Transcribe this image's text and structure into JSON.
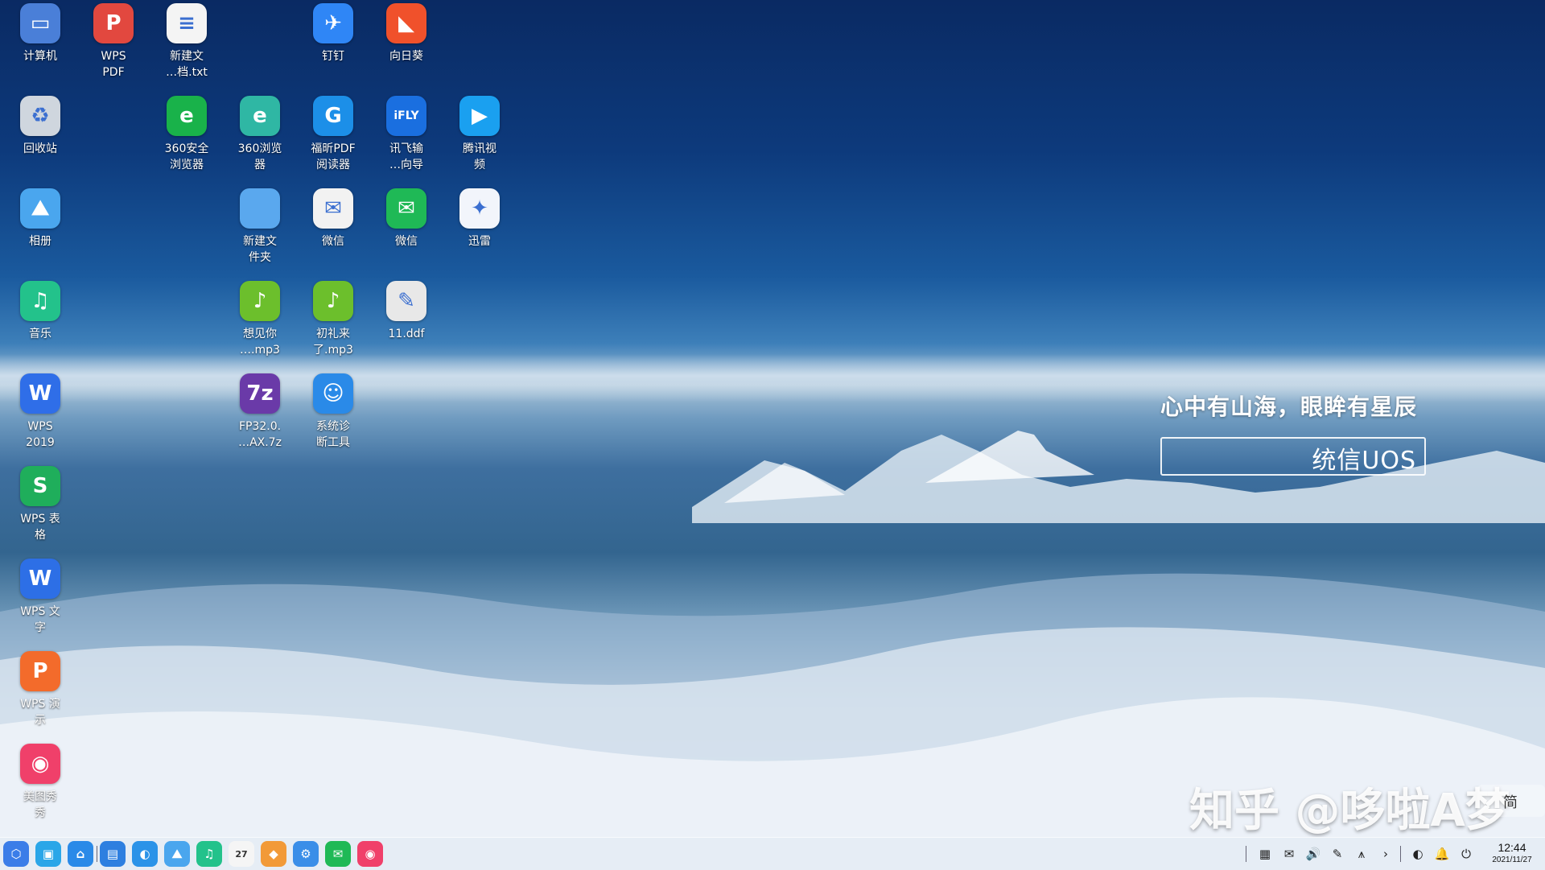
{
  "desktop": {
    "icons": [
      {
        "label": "计算机",
        "glyph": "▭",
        "color": "#4a7fd8",
        "icon": "computer-icon"
      },
      {
        "label": "WPS\nPDF",
        "glyph": "P",
        "color": "#e2483f",
        "icon": "wps-pdf-icon"
      },
      {
        "label": "新建文\n…档.txt",
        "glyph": "≡",
        "color": "#f4f4f4",
        "icon": "text-file-icon"
      },
      {
        "label": "钉钉",
        "glyph": "✈",
        "color": "#2f86f6",
        "icon": "dingtalk-icon"
      },
      {
        "label": "向日葵",
        "glyph": "◣",
        "color": "#f0512b",
        "icon": "sunflower-icon"
      },
      {
        "label": "回收站",
        "glyph": "♻",
        "color": "#cfd6de",
        "icon": "trash-icon"
      },
      {
        "label": "360安全\n浏览器",
        "glyph": "e",
        "color": "#19b24a",
        "icon": "360-secure-browser-icon"
      },
      {
        "label": "360浏览\n器",
        "glyph": "e",
        "color": "#2fb7a4",
        "icon": "360-browser-icon"
      },
      {
        "label": "福昕PDF\n阅读器",
        "glyph": "G",
        "color": "#1c8fe8",
        "icon": "foxit-pdf-icon"
      },
      {
        "label": "讯飞输\n…向导",
        "glyph": "iFLY",
        "color": "#1a6fe0",
        "icon": "iflytek-input-icon"
      },
      {
        "label": "腾讯视\n频",
        "glyph": "▶",
        "color": "#1aa0f0",
        "icon": "tencent-video-icon"
      },
      {
        "label": "相册",
        "glyph": "⛰",
        "color": "#4aa6ee",
        "icon": "album-icon"
      },
      {
        "label": "新建文\n件夹",
        "glyph": "",
        "color": "#5aa8ee",
        "icon": "folder-icon"
      },
      {
        "label": "微信",
        "glyph": "✉",
        "color": "#f2f2f2",
        "icon": "wechat-icon"
      },
      {
        "label": "微信",
        "glyph": "✉",
        "color": "#1fb956",
        "icon": "wechat-icon"
      },
      {
        "label": "迅雷",
        "glyph": "✦",
        "color": "#f2f5fb",
        "icon": "xunlei-icon"
      },
      {
        "label": "音乐",
        "glyph": "♫",
        "color": "#23c28b",
        "icon": "music-icon"
      },
      {
        "label": "想见你\n….mp3",
        "glyph": "♪",
        "color": "#6cbf2c",
        "icon": "mp3-file-icon"
      },
      {
        "label": "初礼来\n了.mp3",
        "glyph": "♪",
        "color": "#6cbf2c",
        "icon": "mp3-file-icon"
      },
      {
        "label": "11.ddf",
        "glyph": "✎",
        "color": "#e8e8e8",
        "icon": "ddf-file-icon"
      },
      {
        "label": "WPS\n2019",
        "glyph": "W",
        "color": "#2f6ee8",
        "icon": "wps-2019-icon"
      },
      {
        "label": "FP32.0.\n…AX.7z",
        "glyph": "7z",
        "color": "#6a3aa8",
        "icon": "archive-7z-icon"
      },
      {
        "label": "系统诊\n断工具",
        "glyph": "☺",
        "color": "#2a8ae8",
        "icon": "system-diagnosis-icon"
      },
      {
        "label": "WPS 表\n格",
        "glyph": "S",
        "color": "#1fae5b",
        "icon": "wps-spreadsheet-icon"
      },
      {
        "label": "WPS 文\n字",
        "glyph": "W",
        "color": "#2d6fe6",
        "icon": "wps-writer-icon"
      },
      {
        "label": "WPS 演\n示",
        "glyph": "P",
        "color": "#f36b2b",
        "icon": "wps-presentation-icon"
      },
      {
        "label": "美图秀\n秀",
        "glyph": "◉",
        "color": "#f0406a",
        "icon": "meitu-icon"
      }
    ]
  },
  "wallpaper": {
    "slogan": "心中有山海，眼眸有星辰",
    "brand": "统信UOS"
  },
  "watermark": "知乎 @哆啦A梦",
  "ime": {
    "label": "简"
  },
  "taskbar": {
    "apps": [
      {
        "icon": "launcher-icon",
        "glyph": "⬡",
        "color": "#3b7de8"
      },
      {
        "icon": "multitask-view-icon",
        "glyph": "▣",
        "color": "#2aa6e8"
      },
      {
        "icon": "home-icon",
        "glyph": "⌂",
        "color": "#2a8ae8"
      },
      {
        "icon": "file-manager-icon",
        "glyph": "▤",
        "color": "#2e7fe0"
      },
      {
        "icon": "browser-icon",
        "glyph": "◐",
        "color": "#2b93e8"
      },
      {
        "icon": "album-icon",
        "glyph": "⛰",
        "color": "#4aa6ee"
      },
      {
        "icon": "music-icon",
        "glyph": "♫",
        "color": "#23c28b"
      },
      {
        "icon": "calendar-icon",
        "glyph": "27",
        "color": "#f5f5f5"
      },
      {
        "icon": "app-store-icon",
        "glyph": "◆",
        "color": "#f29a38"
      },
      {
        "icon": "settings-icon",
        "glyph": "⚙",
        "color": "#3a8ee8"
      },
      {
        "icon": "wechat-icon",
        "glyph": "✉",
        "color": "#1fb956"
      },
      {
        "icon": "meitu-icon",
        "glyph": "◉",
        "color": "#f0406a"
      }
    ],
    "tray": [
      {
        "icon": "tray-app-icon",
        "glyph": "▦"
      },
      {
        "icon": "wechat-tray-icon",
        "glyph": "✉"
      },
      {
        "icon": "volume-icon",
        "glyph": "🔊"
      },
      {
        "icon": "pen-icon",
        "glyph": "✎"
      },
      {
        "icon": "network-icon",
        "glyph": "⩚"
      },
      {
        "icon": "expand-arrow-icon",
        "glyph": "›"
      },
      {
        "icon": "browser-tray-icon",
        "glyph": "◐"
      },
      {
        "icon": "notification-bell-icon",
        "glyph": "🔔"
      },
      {
        "icon": "power-icon",
        "glyph": "⏻"
      }
    ],
    "clock": {
      "time": "12:44",
      "date": "2021/11/27"
    }
  }
}
